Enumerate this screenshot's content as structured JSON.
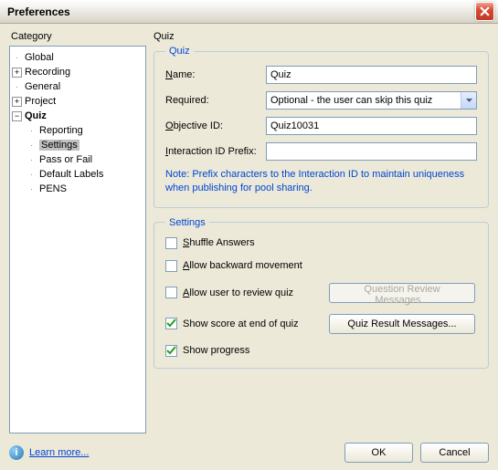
{
  "window": {
    "title": "Preferences"
  },
  "headers": {
    "category": "Category",
    "panel": "Quiz"
  },
  "tree": {
    "global": "Global",
    "recording": "Recording",
    "general": "General",
    "project": "Project",
    "quiz": "Quiz",
    "reporting": "Reporting",
    "settings": "Settings",
    "pass_or_fail": "Pass or Fail",
    "default_labels": "Default Labels",
    "pens": "PENS"
  },
  "quiz_group": {
    "legend": "Quiz",
    "name_label": "Name:",
    "name_value": "Quiz",
    "required_label": "Required:",
    "required_value": "Optional - the user can skip this quiz",
    "objective_label": "Objective ID:",
    "objective_value": "Quiz10031",
    "interaction_label": "Interaction ID Prefix:",
    "interaction_value": "",
    "note": "Note: Prefix characters to the Interaction ID to maintain uniqueness when publishing for pool sharing."
  },
  "settings_group": {
    "legend": "Settings",
    "shuffle": "Shuffle Answers",
    "backward": "Allow backward movement",
    "review": "Allow user to review quiz",
    "review_btn": "Question Review Messages...",
    "score": "Show score at end of quiz",
    "score_btn": "Quiz Result Messages...",
    "progress": "Show progress"
  },
  "footer": {
    "learn": "Learn more...",
    "ok": "OK",
    "cancel": "Cancel"
  },
  "checkbox_state": {
    "shuffle": false,
    "backward": false,
    "review": false,
    "score": true,
    "progress": true
  }
}
